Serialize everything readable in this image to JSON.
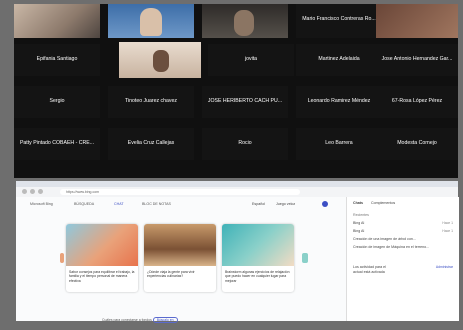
{
  "meeting": {
    "tiles": [
      {
        "name": "Mario Francisco Contreras Ro...",
        "sub": ""
      },
      {
        "name": "Epifania Santiago",
        "sub": ""
      },
      {
        "name": "",
        "sub": ""
      },
      {
        "name": "jovita",
        "sub": ""
      },
      {
        "name": "Martinez Adelaida",
        "sub": ""
      },
      {
        "name": "Jose Antonio Hernandez Gar...",
        "sub": ""
      },
      {
        "name": "Sergio",
        "sub": ""
      },
      {
        "name": "Tinoteo Juarez chavez",
        "sub": ""
      },
      {
        "name": "JOSE HERIBERTO CACH PU...",
        "sub": ""
      },
      {
        "name": "Leonardo Ramirez Méndez",
        "sub": ""
      },
      {
        "name": "67-Rosa López Pérez",
        "sub": ""
      },
      {
        "name": "Patty Pintado COBAEH - CRE...",
        "sub": ""
      },
      {
        "name": "Evelia Cruz Callejas",
        "sub": ""
      },
      {
        "name": "Rocio",
        "sub": ""
      },
      {
        "name": "Leo Barrera",
        "sub": ""
      },
      {
        "name": "Modesta Cornejo",
        "sub": ""
      }
    ]
  },
  "browser": {
    "url": "https://www.bing.com",
    "bing_tabs": [
      "Microsoft Bing",
      "BÚSQUEDA",
      "CHAT",
      "BLOC DE NOTAS"
    ],
    "chips": [
      "Español",
      "Juego veloz"
    ],
    "cards": [
      {
        "caption": "Sabor consejos para equilibrar el trabajo, la familia y el tiempo personal de manera efectiva"
      },
      {
        "caption": "¿Dónde viaja la gente para vivir experiencias culinarias?"
      },
      {
        "caption": "Brainstorm algunas ejercicios de relajación que puedo hacer en cualquier lugar para mejorar"
      }
    ],
    "ask_text": "Cuáles para conectarse a fondos",
    "ask_pill": "Búscalo en",
    "sidebar": {
      "tabs": [
        "Chats",
        "Complementos"
      ],
      "items": [
        {
          "label": "Recientes",
          "right": ""
        },
        {
          "label": "Bing AI",
          "right": "Hace 1"
        },
        {
          "label": "Bing AI",
          "right": "Hace 1"
        },
        {
          "label": "Creación de una imagen de árbol con...",
          "right": ""
        },
        {
          "label": "Creación de imagen de Máquina en el terreno...",
          "right": ""
        }
      ],
      "footer_label": "Los actividad para el",
      "footer_sub": "actual está activada",
      "footer_link": "Administrar"
    }
  },
  "colors": {
    "accent": "#3c4fc4",
    "meet_bg": "#101010"
  }
}
